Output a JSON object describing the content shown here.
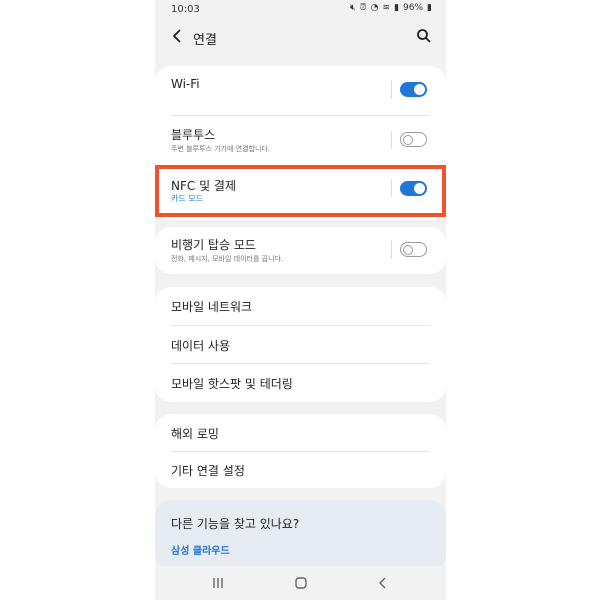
{
  "status": {
    "time": "10:03",
    "battery": "96%"
  },
  "header": {
    "title": "연결"
  },
  "sections": {
    "wifi": {
      "label": "Wi-Fi",
      "toggle": "on"
    },
    "bluetooth": {
      "label": "블루투스",
      "sub": "주변 블루투스 기기에 연결합니다.",
      "toggle": "off"
    },
    "nfc": {
      "label": "NFC 및 결제",
      "sub": "카드 모드",
      "toggle": "on"
    },
    "airplane": {
      "label": "비행기 탑승 모드",
      "sub": "전화, 메시지, 모바일 데이터를 끕니다.",
      "toggle": "off"
    },
    "mobile_network": {
      "label": "모바일 네트워크"
    },
    "data_usage": {
      "label": "데이터 사용"
    },
    "hotspot": {
      "label": "모바일 핫스팟 및 테더링"
    },
    "roaming": {
      "label": "해외 로밍"
    },
    "other": {
      "label": "기타 연결 설정"
    }
  },
  "suggest": {
    "question": "다른 기능을 찾고 있나요?",
    "link": "삼성 클라우드"
  },
  "colors": {
    "accent": "#1f77d8",
    "highlight": "#f0532b",
    "background": "#f2f2f2"
  }
}
